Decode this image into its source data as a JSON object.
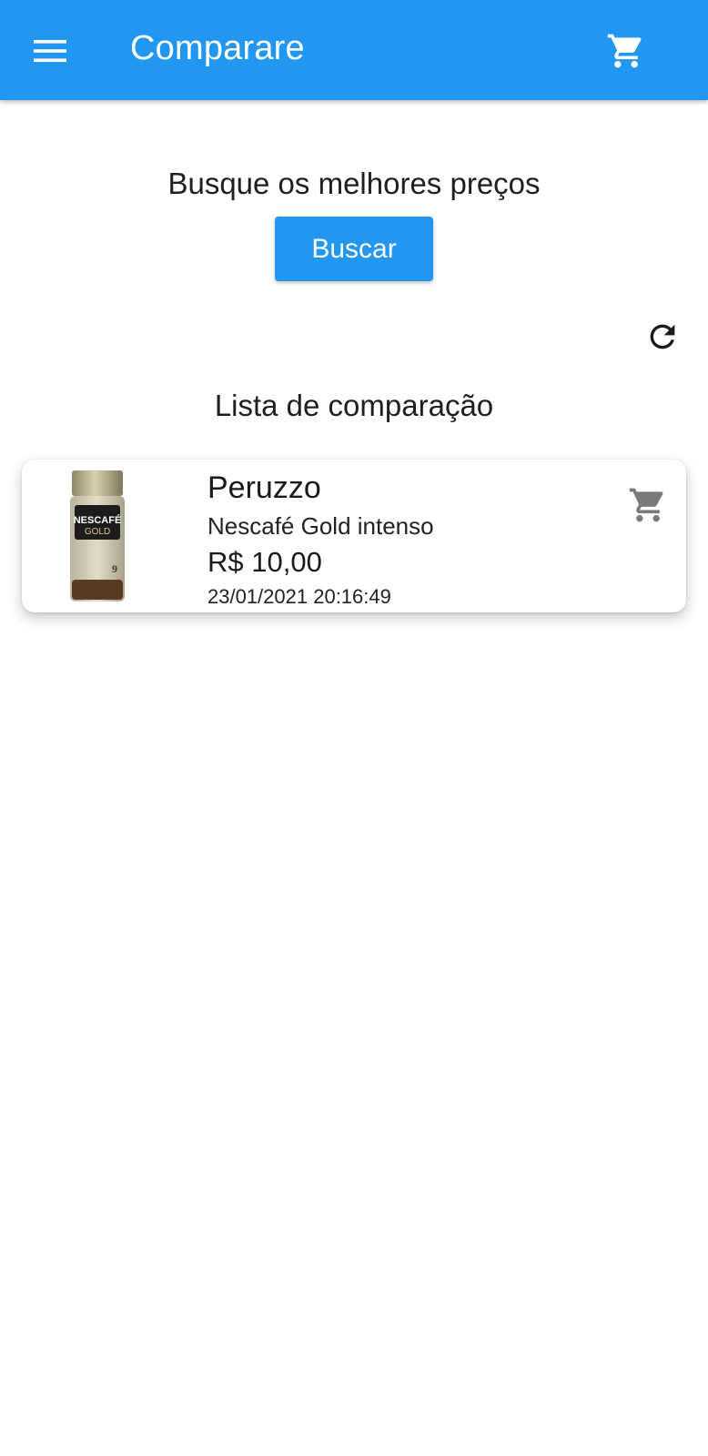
{
  "appbar": {
    "title": "Comparare",
    "menu_icon": "menu-icon",
    "cart_icon": "shopping-cart-icon",
    "color": "#2196F3"
  },
  "search": {
    "heading": "Busque os melhores preços",
    "button_label": "Buscar"
  },
  "refresh_icon": "refresh-icon",
  "comparison_list": {
    "heading": "Lista de comparação",
    "items": [
      {
        "store": "Peruzzo",
        "product": "Nescafé Gold intenso",
        "price": "R$ 10,00",
        "timestamp": "23/01/2021 20:16:49",
        "image_label": "NESCAFÉ GOLD",
        "cart_icon": "add-to-cart-icon"
      }
    ]
  }
}
